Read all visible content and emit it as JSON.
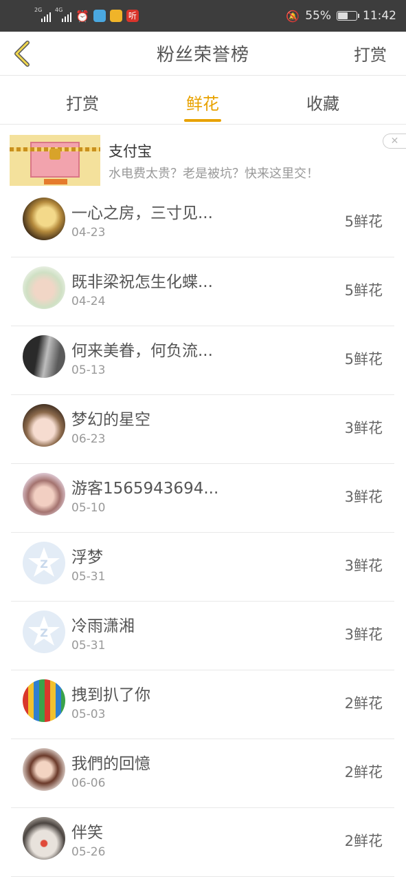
{
  "status_bar": {
    "net1": "2G",
    "net2": "4G",
    "battery": "55%",
    "battery_level": 0.55,
    "time": "11:42",
    "app_label": "听"
  },
  "header": {
    "title": "粉丝荣誉榜",
    "action": "打赏"
  },
  "tabs": [
    {
      "label": "打赏",
      "active": false
    },
    {
      "label": "鲜花",
      "active": true
    },
    {
      "label": "收藏",
      "active": false
    }
  ],
  "ad": {
    "title": "支付宝",
    "description": "水电费太贵？老是被坑？快来这里交！"
  },
  "rank_list": [
    {
      "name": "一心之房，三寸见...",
      "date": "04-23",
      "count": "5鲜花",
      "avatar": "photo-warm"
    },
    {
      "name": "既非梁祝怎生化蝶...",
      "date": "04-24",
      "count": "5鲜花",
      "avatar": "photo-light"
    },
    {
      "name": "何来美眷，何负流...",
      "date": "05-13",
      "count": "5鲜花",
      "avatar": "photo-mono"
    },
    {
      "name": "梦幻的星空",
      "date": "06-23",
      "count": "3鲜花",
      "avatar": "photo-face"
    },
    {
      "name": "游客1565943694...",
      "date": "05-10",
      "count": "3鲜花",
      "avatar": "photo-child"
    },
    {
      "name": "浮梦",
      "date": "05-31",
      "count": "3鲜花",
      "avatar": "qq-default"
    },
    {
      "name": "冷雨潇湘",
      "date": "05-31",
      "count": "3鲜花",
      "avatar": "qq-default"
    },
    {
      "name": "拽到扒了你",
      "date": "05-03",
      "count": "2鲜花",
      "avatar": "photo-pencils"
    },
    {
      "name": "我們的回憶",
      "date": "06-06",
      "count": "2鲜花",
      "avatar": "photo-woman"
    },
    {
      "name": "伴笑",
      "date": "05-26",
      "count": "2鲜花",
      "avatar": "photo-clown"
    }
  ],
  "colors": {
    "accent": "#e8a200",
    "status_bar": "#3d3d3d"
  }
}
